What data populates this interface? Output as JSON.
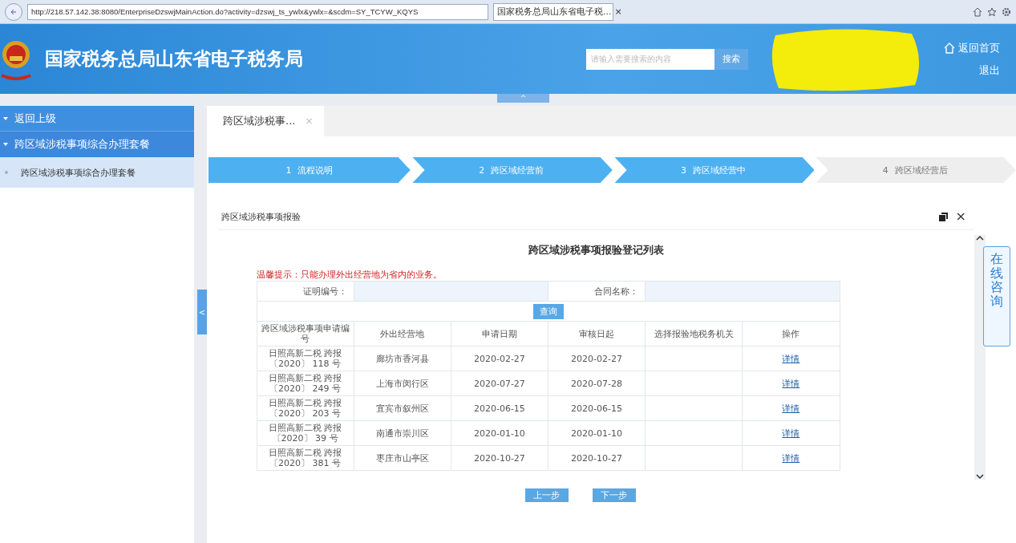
{
  "browser": {
    "url": "http://218.57.142.38:8080/EnterpriseDzswjMainAction.do?activity=dzswj_ts_ywlx&ywlx=&scdm=SY_TCYW_KQYS",
    "tab_title": "国家税务总局山东省电子税...",
    "tab_close": "×"
  },
  "header": {
    "title": "国家税务总局山东省电子税务局",
    "search": {
      "placeholder": "请输入需要搜索的内容",
      "button": "搜索"
    },
    "home_link": "返回首页",
    "logout": "退出",
    "collapse": "^"
  },
  "sidebar": {
    "items": [
      {
        "label": "返回上级",
        "kind": "back",
        "selected": false
      },
      {
        "label": "跨区域涉税事项综合办理套餐",
        "kind": "group",
        "selected": false
      },
      {
        "label": "跨区域涉税事项综合办理套餐",
        "kind": "item",
        "selected": true
      }
    ],
    "handle": "<"
  },
  "tabs": [
    {
      "label": "跨区域涉税事...",
      "close": "×",
      "selected": true
    }
  ],
  "steps": [
    {
      "number": "1",
      "label": "流程说明",
      "completed": true
    },
    {
      "number": "2",
      "label": "跨区域经营前",
      "completed": true
    },
    {
      "number": "3",
      "label": "跨区域经营中",
      "completed": true
    },
    {
      "number": "4",
      "label": "跨区域经营后",
      "completed": false
    }
  ],
  "dialog": {
    "title": "跨区域涉税事项报验",
    "close": "×",
    "heading": "跨区域涉税事项报验登记列表",
    "notice": "温馨提示：只能办理外出经营地为省内的业务。",
    "filters": [
      {
        "label": "证明编号："
      },
      {
        "label": "合同名称："
      }
    ],
    "query_button": "查询",
    "columns": [
      "跨区域涉税事项申请编号",
      "外出经营地",
      "申请日期",
      "审核日起",
      "选择报验地税务机关",
      "操作"
    ],
    "rows": [
      {
        "cells": [
          "日照高新二税 跨报〔2020〕 118 号",
          "廊坊市香河县",
          "2020-02-27",
          "2020-02-27",
          ""
        ],
        "action": "详情"
      },
      {
        "cells": [
          "日照高新二税 跨报〔2020〕 249 号",
          "上海市闵行区",
          "2020-07-27",
          "2020-07-28",
          ""
        ],
        "action": "详情"
      },
      {
        "cells": [
          "日照高新二税 跨报〔2020〕 203 号",
          "宜宾市叙州区",
          "2020-06-15",
          "2020-06-15",
          ""
        ],
        "action": "详情"
      },
      {
        "cells": [
          "日照高新二税 跨报〔2020〕 39 号",
          "南通市崇川区",
          "2020-01-10",
          "2020-01-10",
          ""
        ],
        "action": "详情"
      },
      {
        "cells": [
          "日照高新二税 跨报〔2020〕 381 号",
          "枣庄市山亭区",
          "2020-10-27",
          "2020-10-27",
          ""
        ],
        "action": "详情"
      }
    ],
    "buttons": [
      "上一步",
      "下一步"
    ]
  },
  "consult": "在线咨询"
}
